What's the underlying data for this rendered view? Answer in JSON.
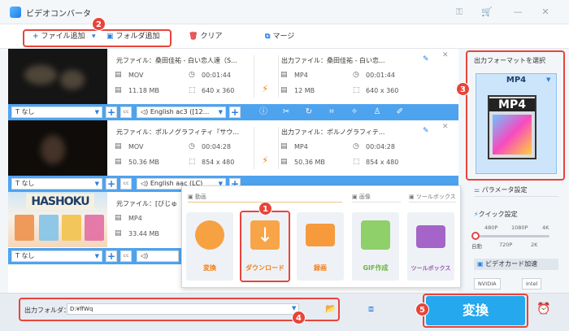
{
  "app": {
    "title": "ビデオコンバータ"
  },
  "toolbar": {
    "add_file": "ファイル追加",
    "add_folder": "フォルダ追加",
    "clear": "クリア",
    "merge": "マージ"
  },
  "files": [
    {
      "source_name": "元ファイル：桑田佳祐 - 白い恋人達（S...",
      "source_format": "MOV",
      "source_duration": "00:01:44",
      "source_size": "11.18 MB",
      "source_res": "640 x 360",
      "output_name": "出力ファイル：桑田佳祐 - 白い恋...",
      "output_format": "MP4",
      "output_duration": "00:01:44",
      "output_size": "12 MB",
      "output_res": "640 x 360",
      "subtitle": "なし",
      "audio": "English ac3 ([12..."
    },
    {
      "source_name": "元ファイル：ポルノグラフィティ『サウ...",
      "source_format": "MOV",
      "source_duration": "00:04:28",
      "source_size": "50.36 MB",
      "source_res": "854 x 480",
      "output_name": "出力ファイル：ポルノグラフィテ...",
      "output_format": "MP4",
      "output_duration": "00:04:28",
      "output_size": "50.36 MB",
      "output_res": "854 x 480",
      "subtitle": "なし",
      "audio": "English aac (LC)"
    },
    {
      "source_name": "元ファイル：[びじゅ",
      "source_format": "MP4",
      "source_size": "33.44 MB",
      "thumb_text": "HASHOKU",
      "subtitle": "なし"
    }
  ],
  "popup": {
    "section_video": "動画",
    "section_image": "画像",
    "section_toolbox": "ツールボックス",
    "tiles": [
      "変換",
      "ダウンロード",
      "録画",
      "GIF作成",
      "ツールボックス"
    ]
  },
  "right_panel": {
    "format_label": "出力フォーマットを選択",
    "format_name": "MP4",
    "format_image_text": "MP4",
    "param_settings": "パラメータ設定",
    "quick_settings": "クイック設定",
    "quick_top": [
      "480P",
      "1080P",
      "4K"
    ],
    "quick_bottom": [
      "自動",
      "720P",
      "2K"
    ],
    "gpu_accel": "ビデオカード加速",
    "gpu_nvidia": "NVIDIA",
    "gpu_intel": "Intel"
  },
  "bottom": {
    "output_label": "出力フォルダ：",
    "output_path": "D:¥ffWq",
    "convert": "変換"
  },
  "badges": [
    "1",
    "2",
    "3",
    "4",
    "5"
  ],
  "colors": {
    "accent": "#25a8ee",
    "highlight": "#e8443a",
    "tile_orange": "#f07e1a"
  }
}
